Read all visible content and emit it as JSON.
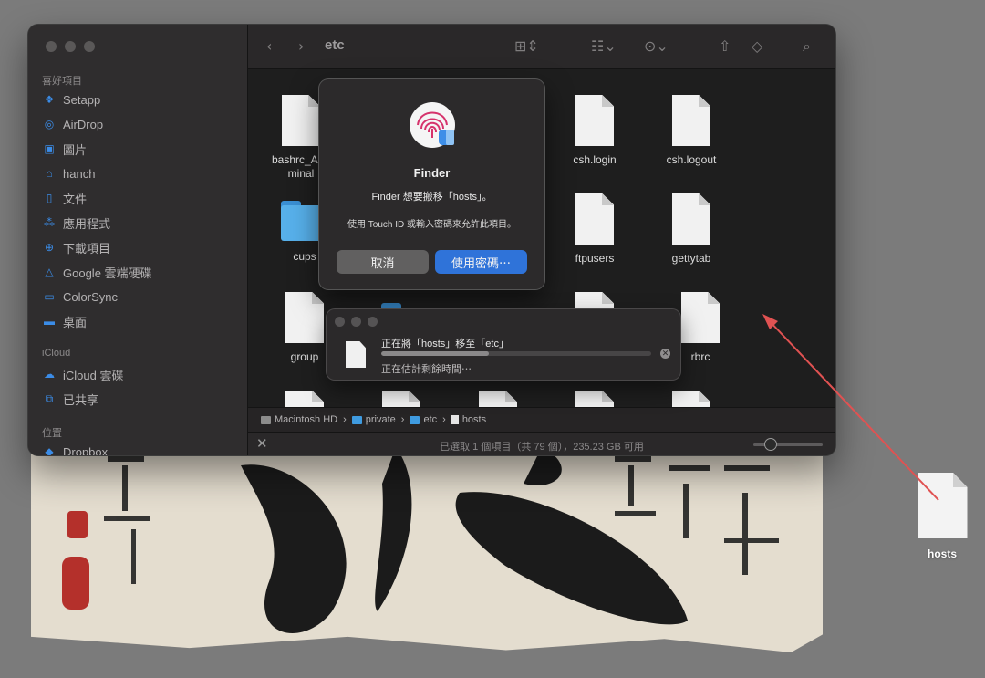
{
  "finder": {
    "sidebar": {
      "favorites_header": "喜好項目",
      "favorites": [
        {
          "label": "Setapp",
          "icon": "setapp-icon"
        },
        {
          "label": "AirDrop",
          "icon": "airdrop-icon"
        },
        {
          "label": "圖片",
          "icon": "photos-icon"
        },
        {
          "label": "hanch",
          "icon": "home-icon"
        },
        {
          "label": "文件",
          "icon": "document-icon"
        },
        {
          "label": "應用程式",
          "icon": "applications-icon"
        },
        {
          "label": "下載項目",
          "icon": "downloads-icon"
        },
        {
          "label": "Google 雲端硬碟",
          "icon": "google-drive-icon"
        },
        {
          "label": "ColorSync",
          "icon": "folder-icon"
        },
        {
          "label": "桌面",
          "icon": "desktop-icon"
        }
      ],
      "icloud_header": "iCloud",
      "icloud": [
        {
          "label": "iCloud 雲碟",
          "icon": "icloud-icon"
        },
        {
          "label": "已共享",
          "icon": "shared-folder-icon"
        }
      ],
      "locations_header": "位置",
      "locations": [
        {
          "label": "Dropbox",
          "icon": "dropbox-icon"
        }
      ]
    },
    "toolbar": {
      "title": "etc"
    },
    "files": [
      {
        "name": "bashrc_Apple_Terminal",
        "display": "bashrc_App\nminal",
        "kind": "doc"
      },
      {
        "name": "csh.login",
        "display": "csh.login",
        "kind": "doc"
      },
      {
        "name": "csh.logout",
        "display": "csh.logout",
        "kind": "doc"
      },
      {
        "name": "cups",
        "display": "cups",
        "kind": "folder"
      },
      {
        "name": "ftpusers",
        "display": "ftpusers",
        "kind": "doc"
      },
      {
        "name": "gettytab",
        "display": "gettytab",
        "kind": "doc"
      },
      {
        "name": "group",
        "display": "group",
        "kind": "doc"
      },
      {
        "name": "rbrc",
        "display": "rbrc",
        "kind": "doc"
      }
    ],
    "pathbar": [
      "Macintosh HD",
      "private",
      "etc",
      "hosts"
    ],
    "status": "已選取 1 個項目（共 79 個），235.23 GB 可用",
    "zoom_level": 0.2
  },
  "auth_dialog": {
    "app": "Finder",
    "message": "Finder 想要搬移「hosts」。",
    "info": "使用 Touch ID 或輸入密碼來允許此項目。",
    "cancel_label": "取消",
    "ok_label": "使用密碼⋯"
  },
  "progress_window": {
    "title": "正在將「hosts」移至「etc」",
    "subtitle": "正在估計剩餘時間⋯",
    "progress": 0.4
  },
  "desktop": {
    "file_label": "hosts"
  },
  "colors": {
    "accent": "#2f73d9",
    "arrow": "#e05252"
  }
}
